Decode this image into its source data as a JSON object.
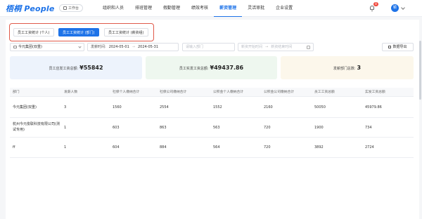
{
  "app": {
    "logo_text": "梧桐 People",
    "workbench_label": "工作台"
  },
  "nav": {
    "items": [
      "组织和人员",
      "排班管理",
      "假勤管理",
      "绩效考核",
      "薪资管理",
      "灵活审批",
      "企业设置"
    ],
    "active_index": 4
  },
  "header": {
    "notification_count": "8",
    "avatar_text": "颖"
  },
  "tabs": [
    {
      "label": "员工工资统计 (个人)",
      "active": false
    },
    {
      "label": "员工工资统计 (部门)",
      "active": true
    },
    {
      "label": "员工工资统计 (薪资组)",
      "active": false
    }
  ],
  "filters": {
    "org_value": "今元集团(双重)",
    "date_label": "发薪时间:",
    "date_start": "2024-05-01",
    "date_sep": "→",
    "date_end": "2024-05-31",
    "dept_placeholder": "请输入部门",
    "period_start_placeholder": "新资开始时间",
    "period_sep": "→",
    "period_end_placeholder": "新资结束时间"
  },
  "toolbar": {
    "export_label": "数据导出"
  },
  "stats": [
    {
      "label": "员工应发工资总额:",
      "value": "¥55842"
    },
    {
      "label": "员工实发工资总额:",
      "value": "¥49437.86"
    },
    {
      "label": "发薪部门总数:",
      "value": "3"
    }
  ],
  "table": {
    "headers": [
      "部门",
      "发薪人数",
      "社保个人缴纳合计",
      "社保公司缴纳合计",
      "公积金个人缴纳合计",
      "公积金公司缴纳合计",
      "员工工资总额",
      "实发工资总额"
    ],
    "rows": [
      [
        "今元集团(双重)",
        "3",
        "1560",
        "2554",
        "1552",
        "2160",
        "50050",
        "45979.86"
      ],
      [
        "杭州今元俊联科技有限公司(测试专用)",
        "1",
        "603",
        "863",
        "563",
        "720",
        "1900",
        "734"
      ],
      [
        "ff",
        "1",
        "604",
        "884",
        "564",
        "720",
        "3892",
        "2724"
      ]
    ]
  },
  "colors": {
    "accent": "#1e73e8",
    "highlight_border": "#e05a4a",
    "badge": "#f04a3e"
  }
}
